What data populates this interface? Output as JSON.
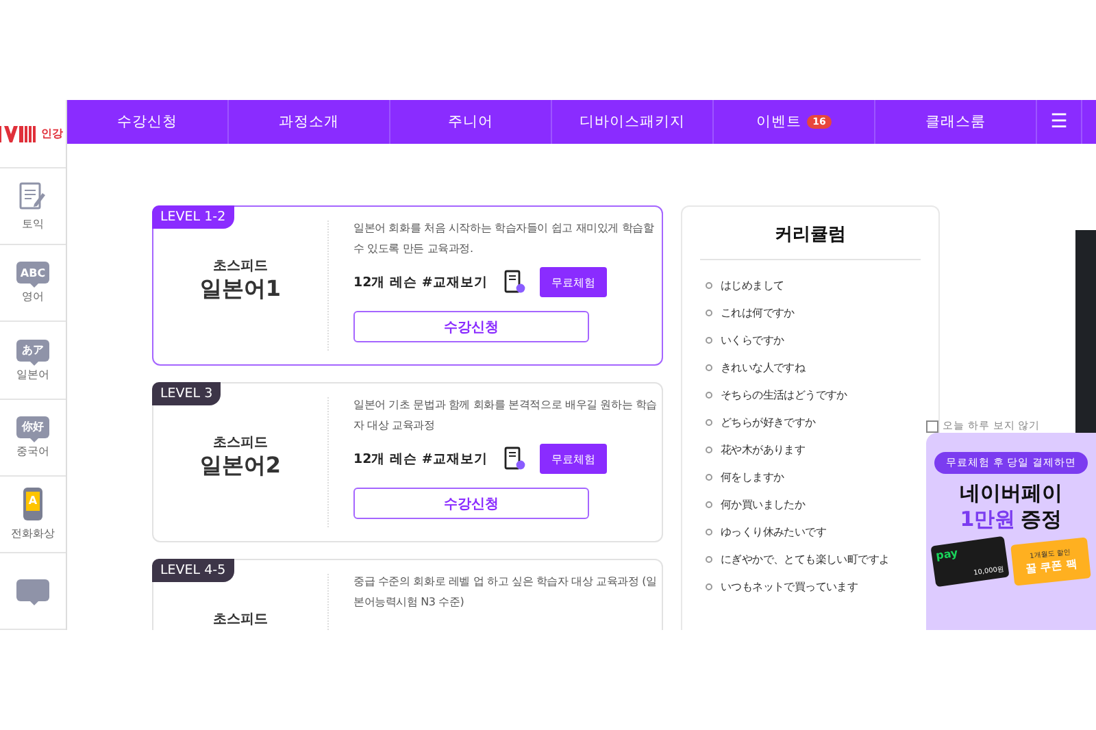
{
  "nav": {
    "items": [
      {
        "label": "수강신청"
      },
      {
        "label": "과정소개"
      },
      {
        "label": "주니어"
      },
      {
        "label": "디바이스패키지"
      },
      {
        "label": "이벤트",
        "badge": "16"
      },
      {
        "label": "클래스룸"
      }
    ],
    "menu_icon": "☰"
  },
  "sidebar": {
    "logo_text": "인강",
    "items": [
      {
        "kind": "doc",
        "label": "토익"
      },
      {
        "kind": "bubble",
        "icon_text": "ABC",
        "label": "영어"
      },
      {
        "kind": "bubble",
        "icon_text": "あア",
        "label": "일본어"
      },
      {
        "kind": "bubble",
        "icon_text": "你好",
        "label": "중국어"
      },
      {
        "kind": "phone",
        "icon_text": "A",
        "label": "전화화상"
      },
      {
        "kind": "bubble"
      }
    ]
  },
  "courses": [
    {
      "level": "LEVEL 1-2",
      "selected": true,
      "subtitle": "초스피드",
      "title": "일본어1",
      "description": "일본어 회화를 처음 시작하는 학습자들이 쉽고 재미있게 학습할 수 있도록 만든 교육과정.",
      "lessons": "12개 레슨 #교재보기",
      "trial_button": "무료체험",
      "apply_button": "수강신청"
    },
    {
      "level": "LEVEL 3",
      "selected": false,
      "subtitle": "초스피드",
      "title": "일본어2",
      "description": "일본어 기초 문법과 함께 회화를 본격적으로 배우길 원하는 학습자 대상 교육과정",
      "lessons": "12개 레슨 #교재보기",
      "trial_button": "무료체험",
      "apply_button": "수강신청"
    },
    {
      "level": "LEVEL 4-5",
      "selected": false,
      "subtitle": "초스피드",
      "description": "중급 수준의 회화로 레벨 업 하고 싶은 학습자 대상 교육과정 (일본어능력시험 N3 수준)"
    }
  ],
  "curriculum": {
    "title": "커리큘럼",
    "items": [
      "はじめまして",
      "これは何ですか",
      "いくらですか",
      "きれいな人ですね",
      "そちらの生活はどうですか",
      "どちらが好きですか",
      "花や木があります",
      "何をしますか",
      "何か買いましたか",
      "ゆっくり休みたいです",
      "にぎやかで、とても楽しい町ですよ",
      "いつもネットで買っています"
    ]
  },
  "popup": {
    "dismiss": {
      "label": "오늘 하루 보지 않기",
      "checked": false
    },
    "banner": {
      "ribbon": "무료체험 후 당일 결제하면",
      "headline": "네이버페이",
      "amount": "1만원",
      "suffix": "증정",
      "card_logo": "pay",
      "card_value": "10,000원",
      "coupon_top": "1개월도 할인",
      "coupon_main": "꿀 쿠폰 팩"
    }
  }
}
